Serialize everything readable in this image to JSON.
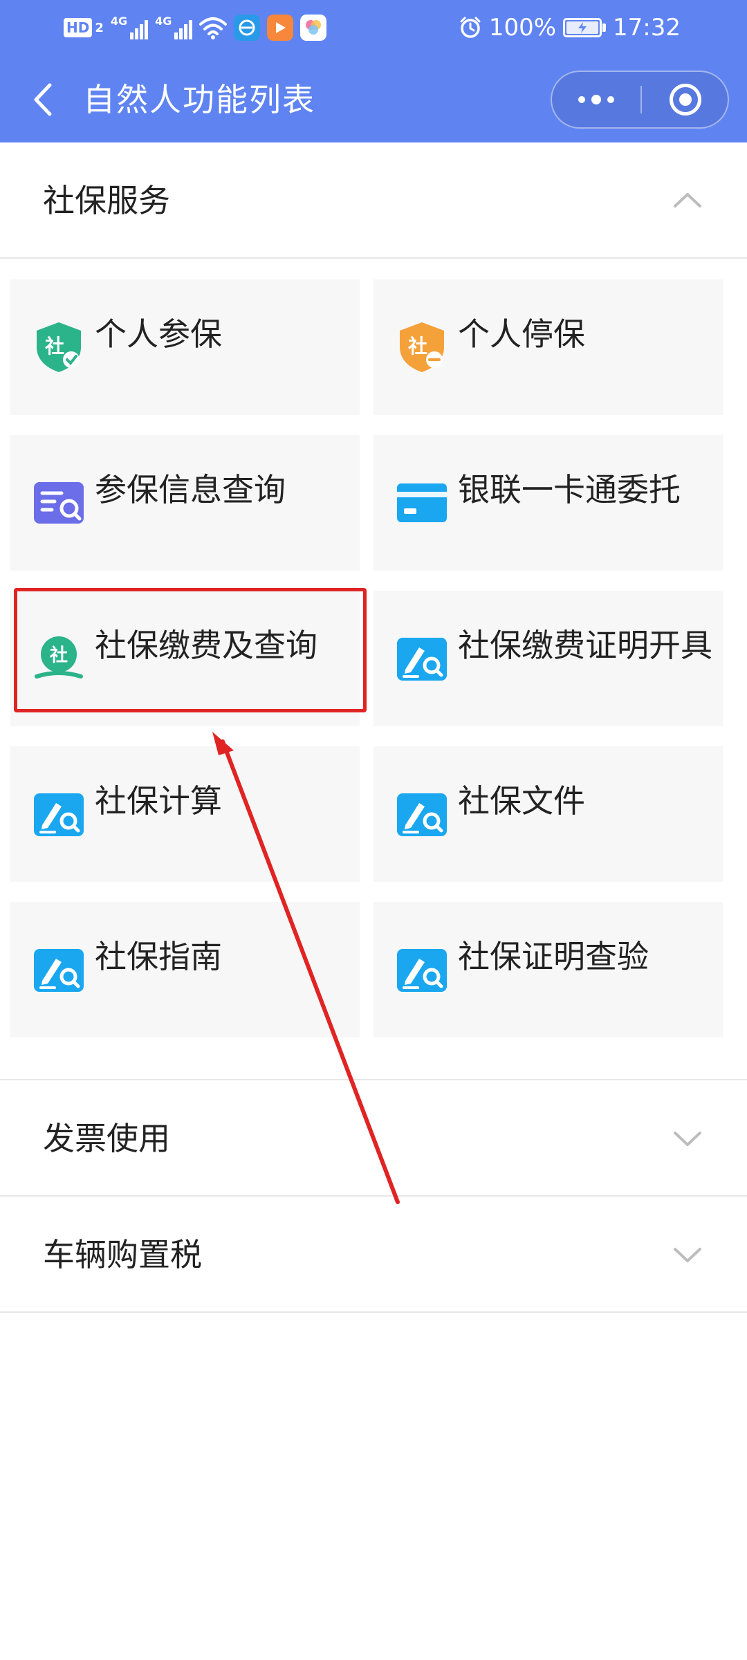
{
  "status_bar": {
    "hd": "HD",
    "hd_sub": "2",
    "net1": "4G",
    "net2": "4G",
    "battery": "100%",
    "time": "17:32"
  },
  "nav": {
    "title": "自然人功能列表"
  },
  "social_security": {
    "title": "社保服务",
    "items": [
      {
        "label": "个人参保"
      },
      {
        "label": "个人停保"
      },
      {
        "label": "参保信息查询"
      },
      {
        "label": "银联一卡通委托"
      },
      {
        "label": "社保缴费及查询"
      },
      {
        "label": "社保缴费证明开具"
      },
      {
        "label": "社保计算"
      },
      {
        "label": "社保文件"
      },
      {
        "label": "社保指南"
      },
      {
        "label": "社保证明查验"
      }
    ]
  },
  "invoice": {
    "title": "发票使用"
  },
  "vehicle_tax": {
    "title": "车辆购置税"
  },
  "colors": {
    "header": "#5f84f2",
    "tile_bg": "#f7f7f7",
    "highlight": "#e02424",
    "green_icon": "#2bb38a",
    "orange_icon": "#f5a13a",
    "purple_icon": "#6b6ee8",
    "blue_icon": "#1aa7f0"
  },
  "icons": {
    "back": "chevron-left-icon",
    "more": "more-dots-icon",
    "close": "target-circle-icon",
    "collapse": "chevron-up-icon",
    "expand": "chevron-down-icon"
  }
}
